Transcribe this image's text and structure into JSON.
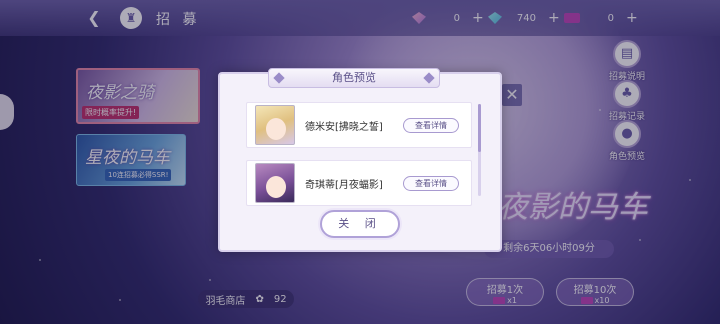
{
  "header": {
    "back_icon": "back-arrow-icon",
    "home_icon": "castle-icon",
    "title": "招 募"
  },
  "currencies": [
    {
      "icon": "pink-diamond-icon",
      "value": "0"
    },
    {
      "icon": "blue-diamond-icon",
      "value": "740"
    },
    {
      "icon": "ticket-icon",
      "value": "0"
    }
  ],
  "left_banners": [
    {
      "title": "夜影之骑",
      "subtitle": "限时概率提升!"
    },
    {
      "title": "星夜的马车",
      "subtitle": "10连招募必得SSR!"
    }
  ],
  "right_buttons": [
    {
      "label": "招募说明",
      "icon": "document-icon"
    },
    {
      "label": "招募记录",
      "icon": "cards-icon"
    },
    {
      "label": "角色预览",
      "icon": "person-icon"
    }
  ],
  "feature": {
    "title": "夜影的马车",
    "time_left": "剩余6天06小时09分"
  },
  "bottom": {
    "shop_label": "羽毛商店",
    "shop_count": "92",
    "recruit_1": {
      "label": "招募1次",
      "cost": "x1"
    },
    "recruit_10": {
      "label": "招募10次",
      "cost": "x10"
    }
  },
  "dialog": {
    "title": "角色预览",
    "characters": [
      {
        "name": "德米安[拂晓之誓]",
        "detail_label": "查看详情"
      },
      {
        "name": "奇琪蒂[月夜蝠影]",
        "detail_label": "查看详情"
      }
    ],
    "close_label": "关 闭"
  },
  "colors": {
    "accent": "#6a5ea8",
    "dialog_bg": "#f4f1fa",
    "ticket": "#c048b8"
  }
}
